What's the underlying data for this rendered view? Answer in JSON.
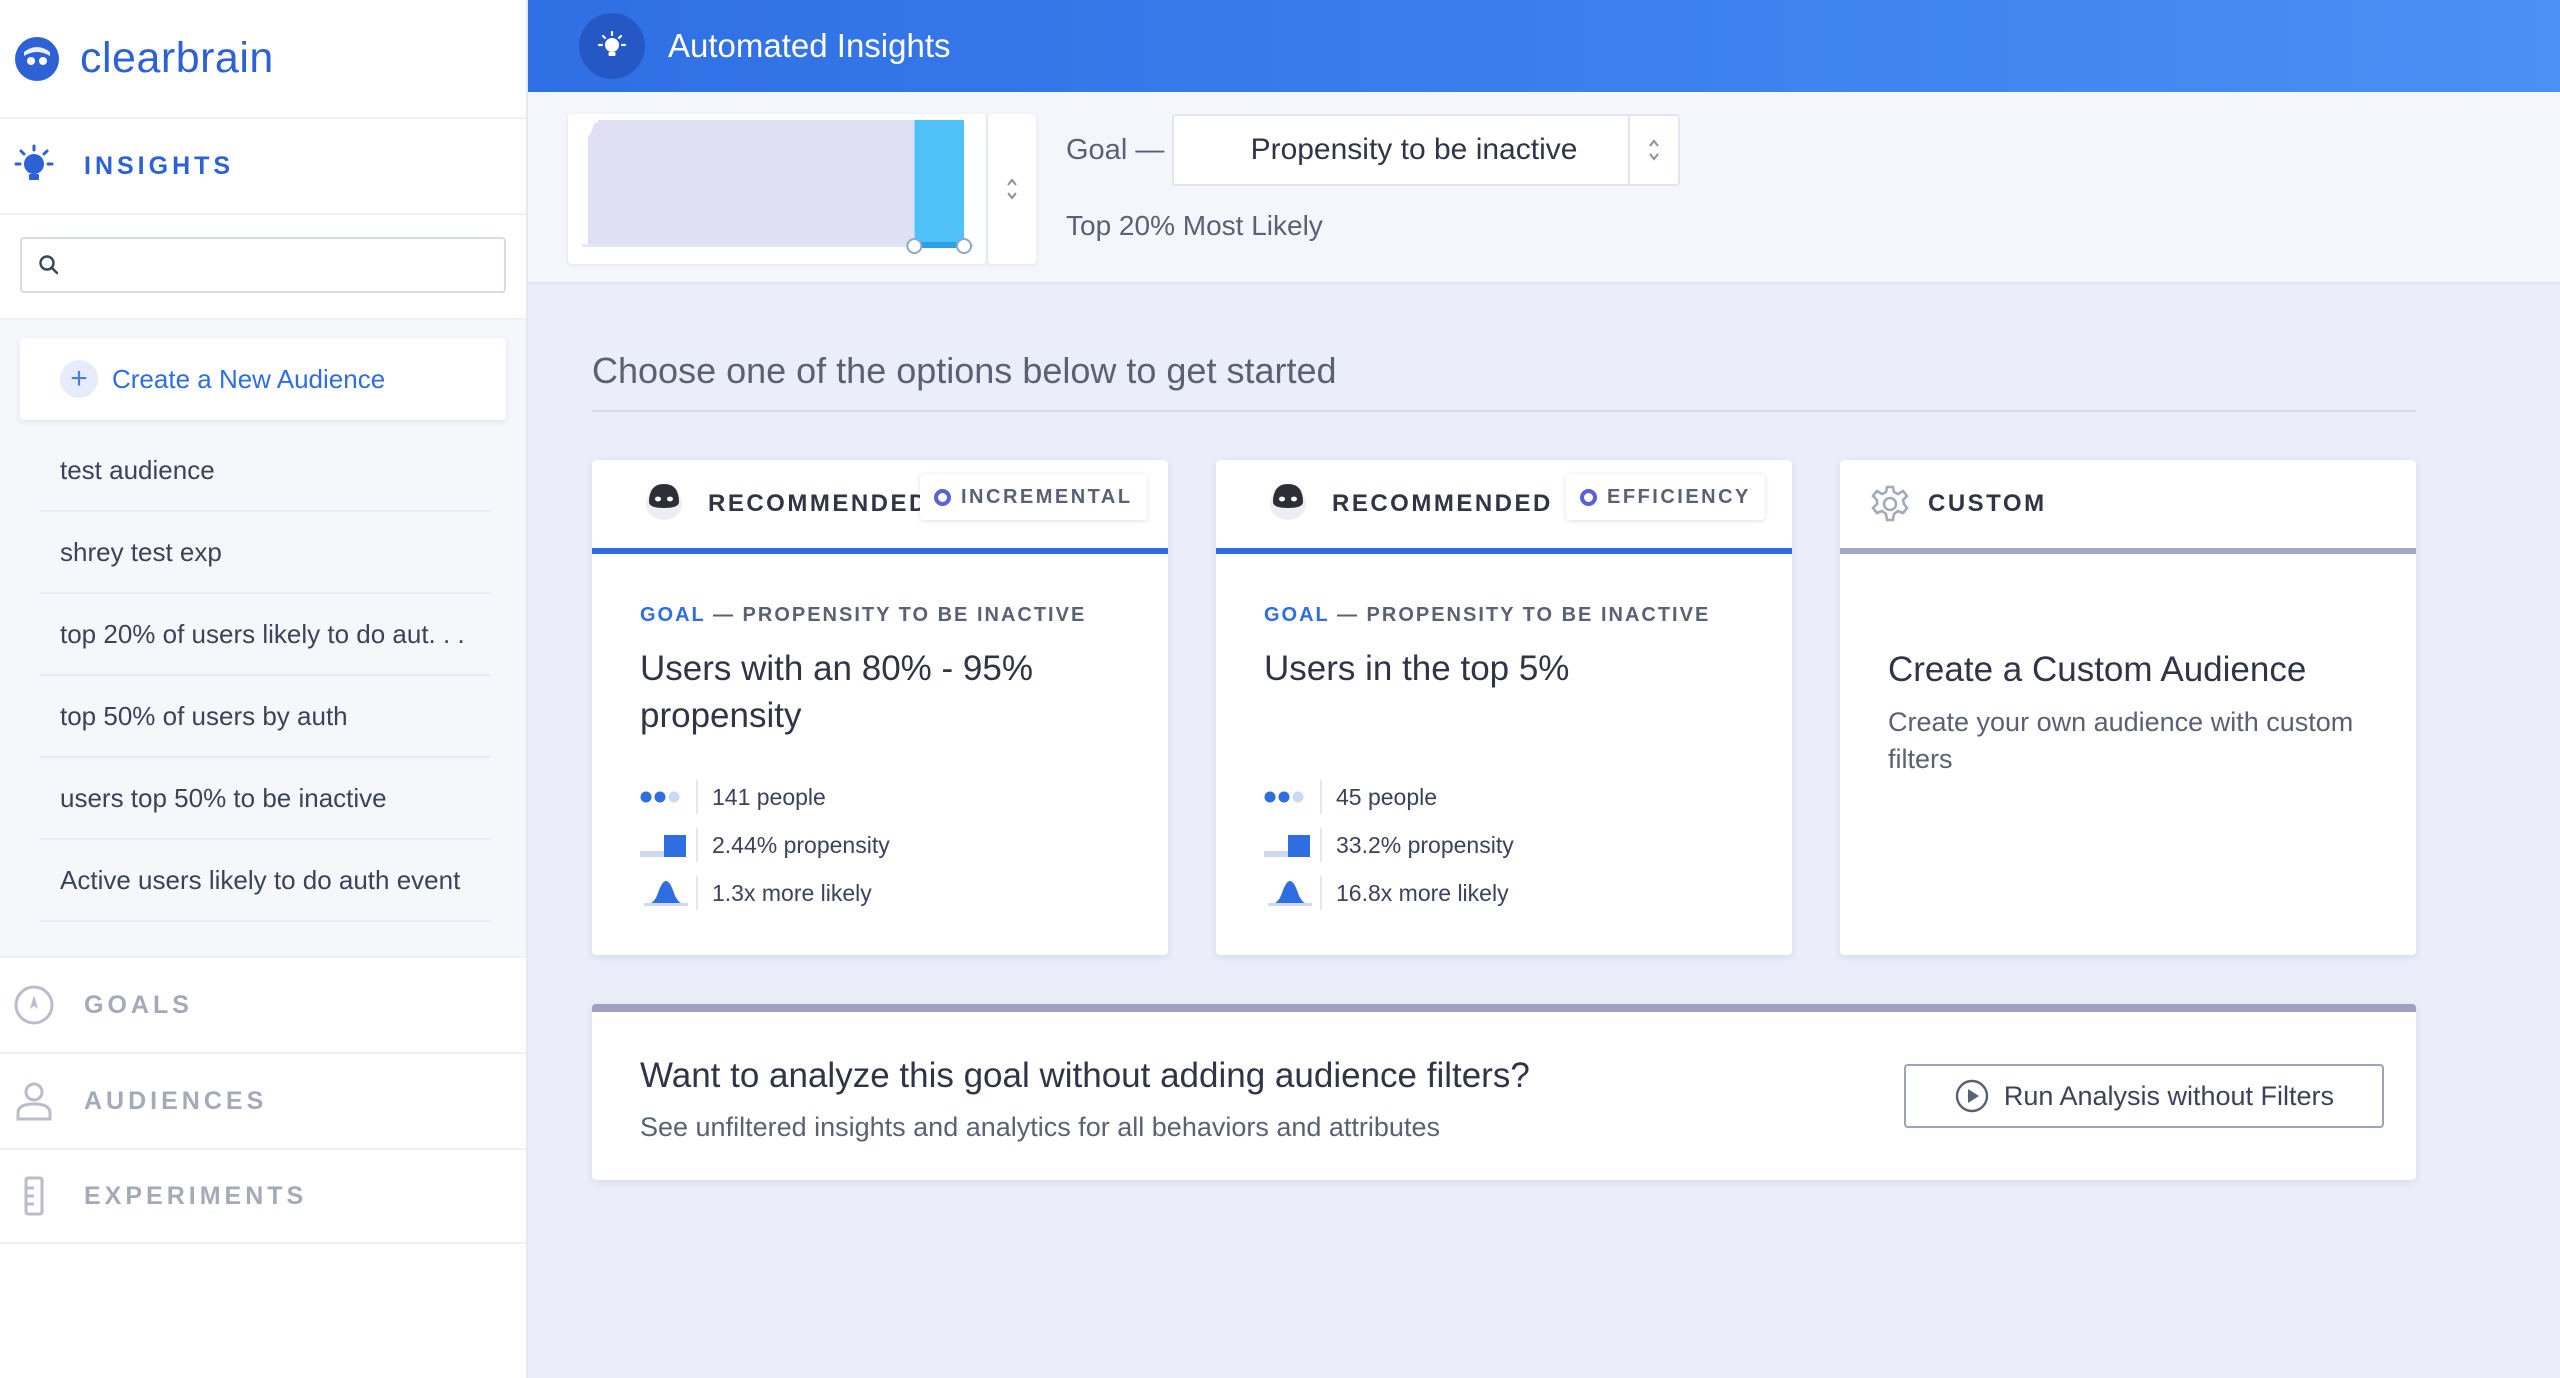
{
  "brand": {
    "name": "clearbrain"
  },
  "sidebar": {
    "active_section": "INSIGHTS",
    "search": {
      "placeholder": "",
      "value": ""
    },
    "create_label": "Create a New Audience",
    "audiences": [
      "test audience",
      "shrey test exp",
      "top 20% of users likely to do aut. . .",
      "top 50% of users by auth",
      "users top 50% to be inactive",
      "Active users likely to do auth event"
    ],
    "nav": [
      "GOALS",
      "AUDIENCES",
      "EXPERIMENTS"
    ]
  },
  "header": {
    "title": "Automated Insights"
  },
  "goal_bar": {
    "goal_label": "Goal —",
    "goal_value": "Propensity to be inactive",
    "subtitle": "Top 20% Most Likely",
    "selected_top_fraction": 0.2
  },
  "main": {
    "prompt": "Choose one of the options below to get started",
    "cards": [
      {
        "label": "RECOMMENDED",
        "tag": "INCREMENTAL",
        "goal_key": "GOAL",
        "goal_rest": " — PROPENSITY TO BE INACTIVE",
        "title": "Users with an 80% - 95% propensity",
        "stats": [
          "141 people",
          "2.44% propensity",
          "1.3x more likely"
        ]
      },
      {
        "label": "RECOMMENDED",
        "tag": "EFFICIENCY",
        "goal_key": "GOAL",
        "goal_rest": " — PROPENSITY TO BE INACTIVE",
        "title": "Users in the top 5%",
        "stats": [
          "45 people",
          "33.2% propensity",
          "16.8x more likely"
        ]
      },
      {
        "label": "CUSTOM",
        "title": "Create a Custom Audience",
        "desc": "Create your own audience with custom filters"
      }
    ],
    "analyze": {
      "title": "Want to analyze this goal without adding audience filters?",
      "desc": "See unfiltered insights and analytics for all behaviors and attributes",
      "button": "Run Analysis without Filters"
    }
  },
  "colors": {
    "accent": "#2f6ee0",
    "header_start": "#2f6fe4",
    "header_end": "#4b90f4",
    "histogram_selected": "#4fc1f7",
    "histogram_base": "#dfe0f4"
  }
}
